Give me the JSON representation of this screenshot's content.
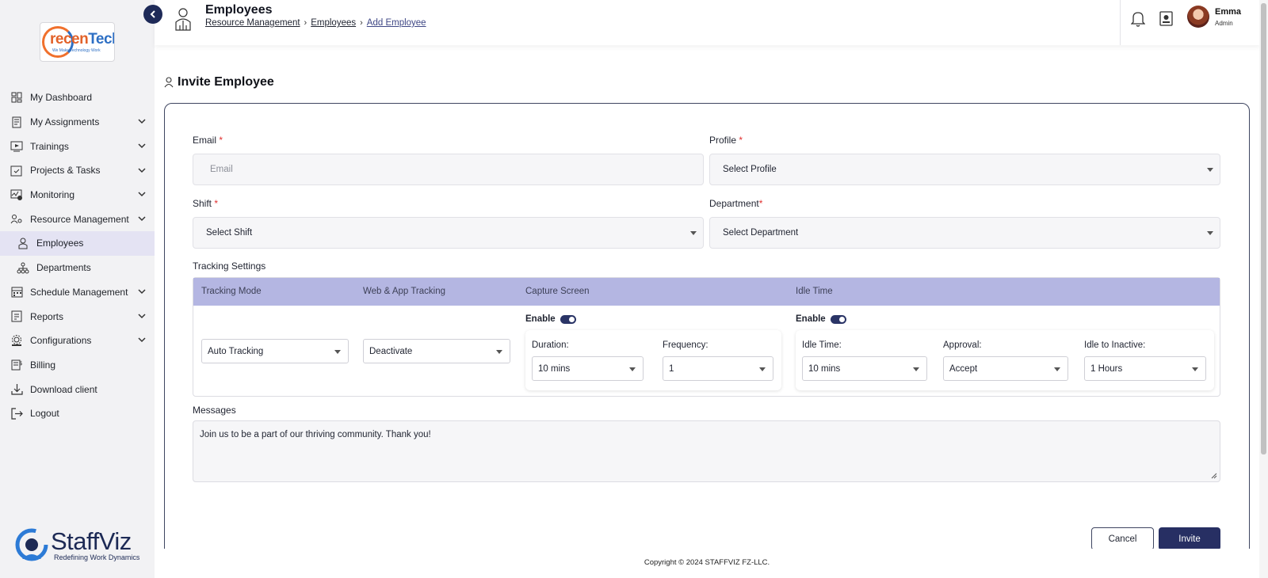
{
  "logo": {
    "part1": "recen",
    "part2": "Tech",
    "tagline": "We Make Technology Work"
  },
  "sidebar": {
    "items": [
      {
        "label": "My Dashboard",
        "icon": "dashboard-icon",
        "expandable": false
      },
      {
        "label": "My Assignments",
        "icon": "assignments-icon",
        "expandable": true
      },
      {
        "label": "Trainings",
        "icon": "trainings-icon",
        "expandable": true
      },
      {
        "label": "Projects & Tasks",
        "icon": "projects-icon",
        "expandable": true
      },
      {
        "label": "Monitoring",
        "icon": "monitoring-icon",
        "expandable": true
      },
      {
        "label": "Resource Management",
        "icon": "resource-icon",
        "expandable": true
      },
      {
        "label": "Employees",
        "icon": "employees-icon",
        "sub": true,
        "active": true
      },
      {
        "label": "Departments",
        "icon": "departments-icon",
        "sub": true
      },
      {
        "label": "Schedule Management",
        "icon": "schedule-icon",
        "expandable": true
      },
      {
        "label": "Reports",
        "icon": "reports-icon",
        "expandable": true
      },
      {
        "label": "Configurations",
        "icon": "configurations-icon",
        "expandable": true
      },
      {
        "label": "Billing",
        "icon": "billing-icon",
        "expandable": false
      },
      {
        "label": "Download client",
        "icon": "download-icon",
        "expandable": false
      },
      {
        "label": "Logout",
        "icon": "logout-icon",
        "expandable": false
      }
    ]
  },
  "brand": {
    "name": "StaffViz",
    "tagline": "Redefining Work Dynamics"
  },
  "header": {
    "title": "Employees",
    "breadcrumbs": [
      "Resource Management",
      "Employees",
      "Add Employee"
    ],
    "user": {
      "name": "Emma",
      "role": "Admin"
    }
  },
  "page": {
    "title": "Invite Employee"
  },
  "form": {
    "email": {
      "label": "Email",
      "required": "*",
      "placeholder": "Email"
    },
    "profile": {
      "label": "Profile",
      "required": "*",
      "value": "Select Profile"
    },
    "shift": {
      "label": "Shift",
      "required": "*",
      "value": "Select Shift"
    },
    "department": {
      "label": "Department",
      "required": "*",
      "value": "Select Department"
    },
    "tracking": {
      "section_label": "Tracking Settings",
      "headers": [
        "Tracking Mode",
        "Web & App Tracking",
        "Capture Screen",
        "Idle Time"
      ],
      "tracking_mode": "Auto Tracking",
      "web_app": "Deactivate",
      "capture": {
        "enable_label": "Enable",
        "enabled": true,
        "duration_label": "Duration:",
        "duration": "10 mins",
        "frequency_label": "Frequency:",
        "frequency": "1"
      },
      "idle": {
        "enable_label": "Enable",
        "enabled": true,
        "idle_time_label": "Idle Time:",
        "idle_time": "10 mins",
        "approval_label": "Approval:",
        "approval": "Accept",
        "inactive_label": "Idle to Inactive:",
        "inactive": "1 Hours"
      }
    },
    "messages": {
      "label": "Messages",
      "value": "Join us to be a part of our thriving community. Thank you!"
    },
    "cancel_label": "Cancel",
    "invite_label": "Invite"
  },
  "footer": {
    "copyright": "Copyright © 2024 STAFFVIZ FZ-LLC."
  },
  "colors": {
    "accent": "#272f63",
    "table_header": "#b4b6e2",
    "active_nav": "#e4e3f3",
    "required": "#e0302f"
  }
}
